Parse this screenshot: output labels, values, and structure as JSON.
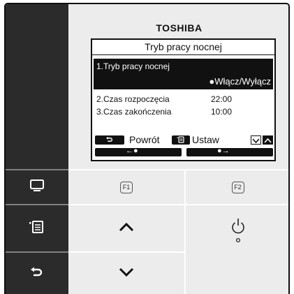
{
  "brand": "TOSHIBA",
  "screen": {
    "title": "Tryb pracy nocnej",
    "selected_label": "1.Tryb pracy nocnej",
    "selected_value": "●Włącz/Wyłącz",
    "rows": [
      {
        "label": "2.Czas rozpoczęcia",
        "value": "22:00"
      },
      {
        "label": "3.Czas zakończenia",
        "value": "10:00"
      }
    ],
    "back_label": "Powrót",
    "set_label": "Ustaw",
    "left_bar_label": "←●",
    "right_bar_label": "●→"
  },
  "keys": {
    "f1": "F1",
    "f2": "F2"
  },
  "icons": {
    "monitor": "monitor-icon",
    "menu": "menu-icon",
    "back": "back-icon",
    "up": "chevron-up-icon",
    "down": "chevron-down-icon",
    "power": "power-icon"
  },
  "colors": {
    "left_panel": "#2b2b2b",
    "body": "#ececec",
    "screen_bg": "#ffffff",
    "highlight": "#111111"
  }
}
